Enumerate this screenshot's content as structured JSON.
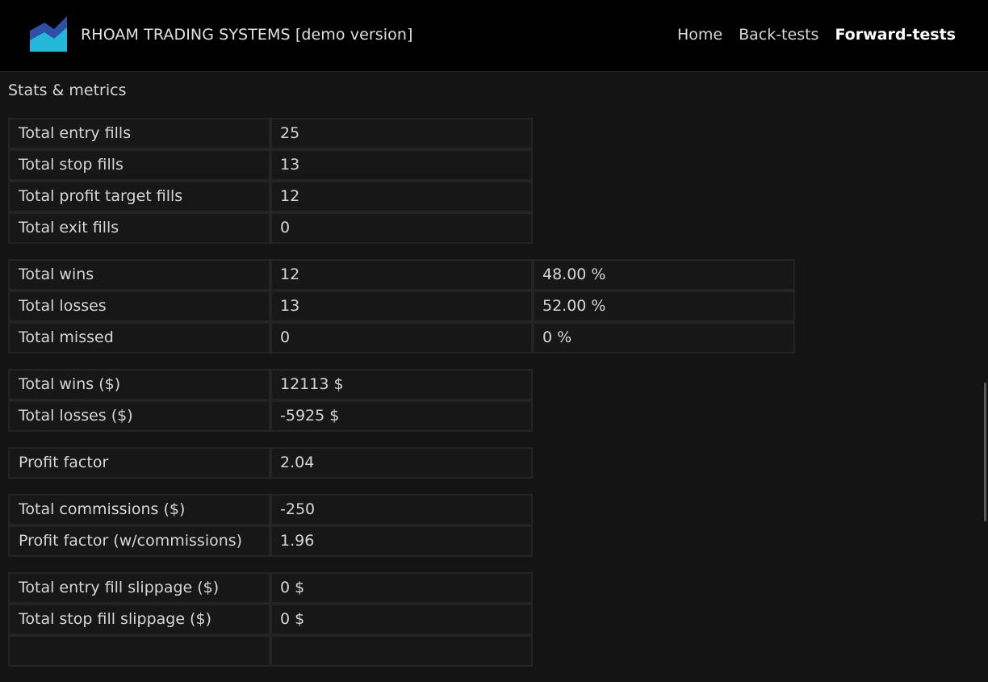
{
  "header": {
    "brand": "RHOAM TRADING SYSTEMS [demo version]",
    "nav": [
      {
        "label": "Home"
      },
      {
        "label": "Back-tests"
      },
      {
        "label": "Forward-tests"
      }
    ],
    "active_nav": "Forward-tests",
    "logo_colors": {
      "dark": "#2f4fa6",
      "light": "#23b8d8"
    }
  },
  "section_title": "Stats & metrics",
  "groups": [
    [
      {
        "label": "Total entry fills",
        "value": "25"
      },
      {
        "label": "Total stop fills",
        "value": "13"
      },
      {
        "label": "Total profit target fills",
        "value": "12"
      },
      {
        "label": "Total exit fills",
        "value": "0"
      }
    ],
    [
      {
        "label": "Total wins",
        "value": "12",
        "pct": "48.00 %"
      },
      {
        "label": "Total losses",
        "value": "13",
        "pct": "52.00 %"
      },
      {
        "label": "Total missed",
        "value": "0",
        "pct": "0 %"
      }
    ],
    [
      {
        "label": "Total wins ($)",
        "value": "12113 $"
      },
      {
        "label": "Total losses ($)",
        "value": "-5925 $"
      }
    ],
    [
      {
        "label": "Profit factor",
        "value": "2.04"
      }
    ],
    [
      {
        "label": "Total commissions ($)",
        "value": "-250"
      },
      {
        "label": "Profit factor (w/commissions)",
        "value": "1.96"
      }
    ],
    [
      {
        "label": "Total entry fill slippage ($)",
        "value": "0 $"
      },
      {
        "label": "Total stop fill slippage ($)",
        "value": "0 $"
      },
      {
        "label": "",
        "value": ""
      }
    ]
  ]
}
